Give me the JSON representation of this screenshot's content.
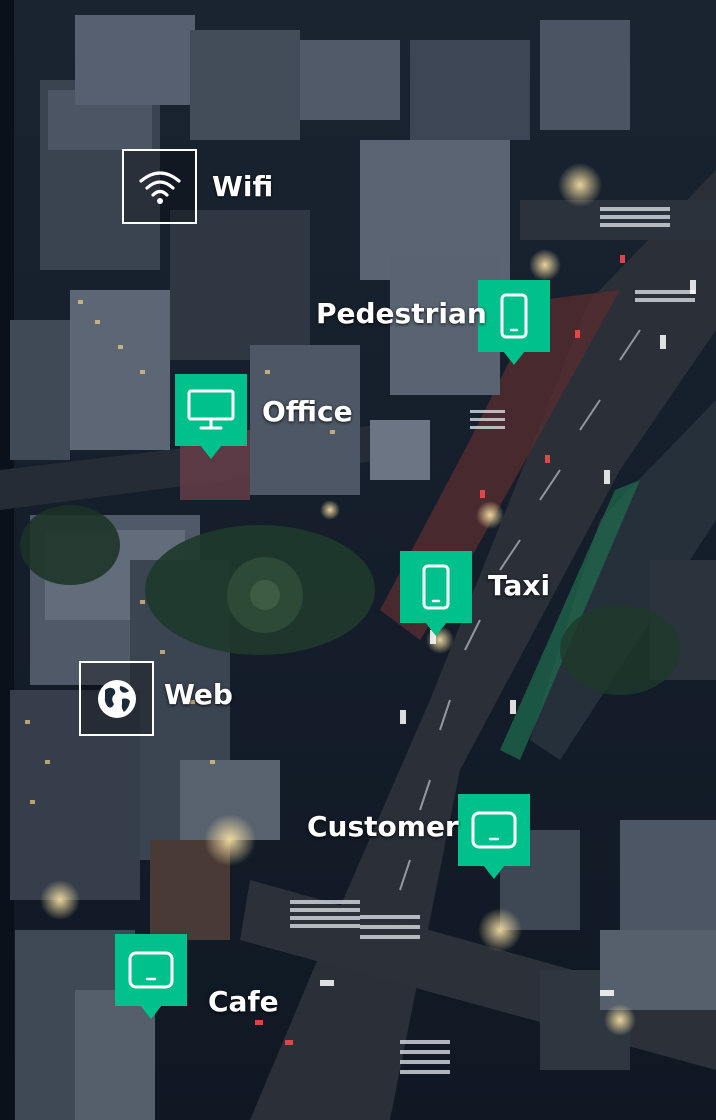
{
  "markers": [
    {
      "id": "wifi",
      "label": "Wifi",
      "icon": "wifi-icon",
      "style": "outlined-box"
    },
    {
      "id": "pedestrian",
      "label": "Pedestrian",
      "icon": "smartphone-icon",
      "style": "green-pin"
    },
    {
      "id": "office",
      "label": "Office",
      "icon": "desktop-monitor-icon",
      "style": "green-pin"
    },
    {
      "id": "taxi",
      "label": "Taxi",
      "icon": "smartphone-icon",
      "style": "green-pin"
    },
    {
      "id": "web",
      "label": "Web",
      "icon": "globe-icon",
      "style": "outlined-box"
    },
    {
      "id": "customer",
      "label": "Customer",
      "icon": "laptop-screen-icon",
      "style": "green-pin"
    },
    {
      "id": "cafe",
      "label": "Cafe",
      "icon": "laptop-screen-icon",
      "style": "green-pin"
    }
  ],
  "colors": {
    "pin": "#00c08b",
    "label": "#ffffff",
    "night_sky": "#0d1622"
  }
}
